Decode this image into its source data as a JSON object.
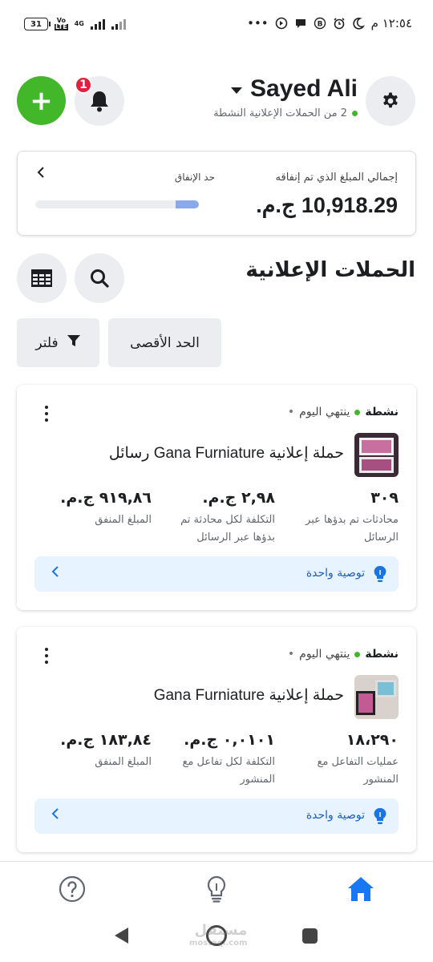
{
  "status_bar": {
    "battery": "31",
    "net_top": "Vo",
    "net_lte": "LTE",
    "net_4g": "4G",
    "time": "١٢:٥٤ م",
    "dots": "•••"
  },
  "header": {
    "account_name": "Sayed Ali",
    "active_campaigns_text": "2 من الحملات الإعلانية النشطة",
    "notification_count": "1",
    "add_icon": "+"
  },
  "spend": {
    "total_label": "إجمالي المبلغ الذي تم إنفاقه",
    "total_value": "10,918.29 ج.م.",
    "limit_label": "حد الإنفاق",
    "limit_fraction": 0.14
  },
  "campaigns_section": {
    "title": "الحملات الإعلانية",
    "max_chip": "الحد الأقصى",
    "filter_chip": "فلتر"
  },
  "campaigns": [
    {
      "status": "نشطة",
      "ends": "ينتهي اليوم",
      "title": "حملة إعلانية Gana Furniature رسائل",
      "metrics": [
        {
          "value": "٣٠٩",
          "label": "محادثات تم بدؤها عبر الرسائل"
        },
        {
          "value": "٢,٩٨ ج.م.",
          "label": "التكلفة لكل محادثة تم بدؤها عبر الرسائل"
        },
        {
          "value": "٩١٩,٨٦ ج.م.",
          "label": "المبلغ المنفق"
        }
      ],
      "recommendation": "توصية واحدة"
    },
    {
      "status": "نشطة",
      "ends": "ينتهي اليوم",
      "title": "حملة إعلانية Gana Furniature",
      "metrics": [
        {
          "value": "١٨،٢٩٠",
          "label": "عمليات التفاعل مع المنشور"
        },
        {
          "value": "٠,٠١٠١ ج.م.",
          "label": "التكلفة لكل تفاعل مع المنشور"
        },
        {
          "value": "١٨٣,٨٤ ج.م.",
          "label": "المبلغ المنفق"
        }
      ],
      "recommendation": "توصية واحدة"
    }
  ],
  "bottom_nav": {
    "items": [
      "help-icon",
      "lightbulb-icon",
      "home-icon"
    ],
    "active_color": "#1877f2"
  },
  "watermark": {
    "text": "مستقل",
    "sub": "mostaql.com"
  }
}
